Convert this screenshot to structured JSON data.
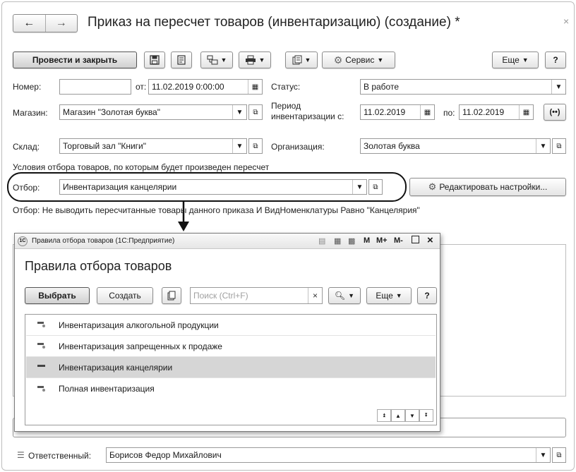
{
  "window": {
    "title": "Приказ на пересчет товаров (инвентаризацию) (создание) *",
    "close_glyph": "×"
  },
  "toolbar": {
    "post_close": "Провести и закрыть",
    "service": "Сервис",
    "more": "Еще",
    "help": "?"
  },
  "form": {
    "number_label": "Номер:",
    "number_value": "",
    "from_label": "от:",
    "date_value": "11.02.2019  0:00:00",
    "status_label": "Статус:",
    "status_value": "В работе",
    "store_label": "Магазин:",
    "store_value": "Магазин \"Золотая буква\"",
    "period_label_1": "Период",
    "period_label_2": "инвентаризации с:",
    "period_from": "11.02.2019",
    "period_to_label": "по:",
    "period_to": "11.02.2019",
    "warehouse_label": "Склад:",
    "warehouse_value": "Торговый зал \"Книги\"",
    "org_label": "Организация:",
    "org_value": "Золотая буква",
    "conditions_caption": "Условия отбора товаров, по которым будет произведен пересчет",
    "filter_label": "Отбор:",
    "filter_value": "Инвентаризация канцелярии",
    "edit_settings": "Редактировать настройки...",
    "filter_description": "Отбор: Не выводить пересчитанные товары данного приказа И ВидНоменклатуры Равно \"Канцелярия\"",
    "responsible_label": "Ответственный:",
    "responsible_value": "Борисов Федор Михайлович"
  },
  "popup": {
    "titlebar": "Правила отбора товаров  (1С:Предприятие)",
    "tb_m": "M",
    "tb_mplus": "M+",
    "tb_mminus": "M-",
    "tb_close": "×",
    "heading": "Правила отбора товаров",
    "select": "Выбрать",
    "create": "Создать",
    "search_placeholder": "Поиск (Ctrl+F)",
    "more": "Еще",
    "help": "?",
    "items": [
      {
        "label": "Инвентаризация алкогольной продукции",
        "selected": false
      },
      {
        "label": "Инвентаризация запрещенных к продаже",
        "selected": false
      },
      {
        "label": "Инвентаризация канцелярии",
        "selected": true
      },
      {
        "label": "Полная инвентаризация",
        "selected": false
      }
    ]
  }
}
